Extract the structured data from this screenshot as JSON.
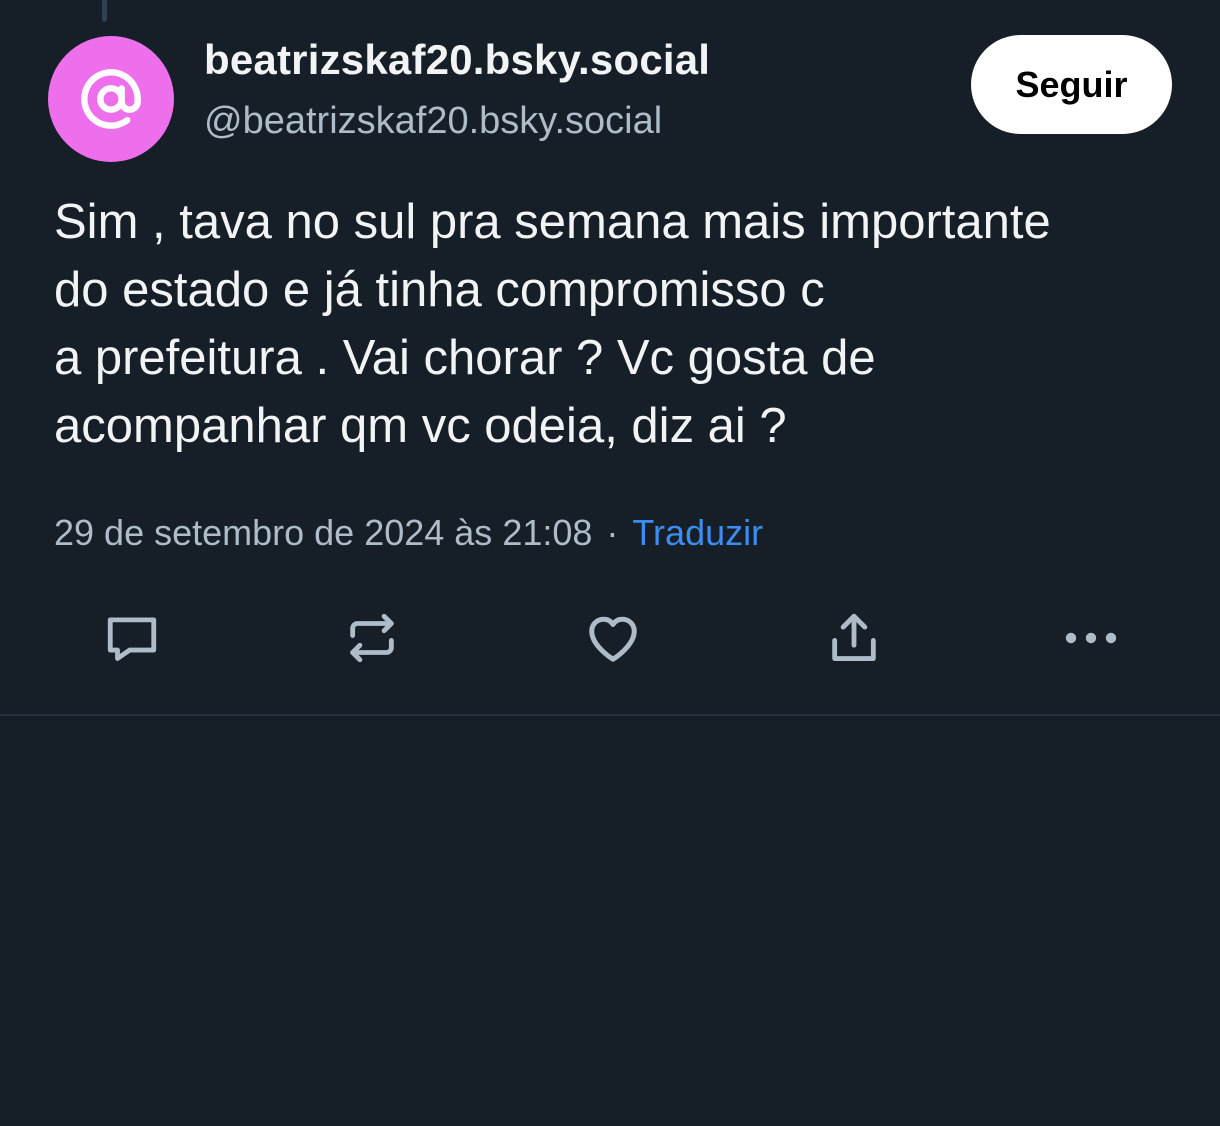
{
  "post": {
    "author": {
      "display_name": "beatrizskaf20.bsky.social",
      "handle": "@beatrizskaf20.bsky.social",
      "avatar_icon": "at-sign-icon",
      "avatar_color": "#ed6fec"
    },
    "follow_label": "Seguir",
    "text_lines": [
      "Sim , tava no sul pra semana mais importante",
      "do estado e já tinha compromisso c",
      "a prefeitura . Vai chorar ? Vc gosta de",
      "acompanhar qm vc odeia, diz ai ?"
    ],
    "timestamp": "29 de setembro de 2024 às 21:08",
    "separator": "·",
    "translate_label": "Traduzir",
    "actions": [
      {
        "name": "reply",
        "icon": "reply-icon"
      },
      {
        "name": "repost",
        "icon": "repost-icon"
      },
      {
        "name": "like",
        "icon": "heart-icon"
      },
      {
        "name": "share",
        "icon": "share-icon"
      },
      {
        "name": "more",
        "icon": "more-options-icon"
      }
    ]
  },
  "colors": {
    "background": "#161e27",
    "primary_text": "#f1f3f5",
    "secondary_text": "#aebbc9",
    "link": "#3b8df0",
    "icon": "#aebbc9"
  }
}
